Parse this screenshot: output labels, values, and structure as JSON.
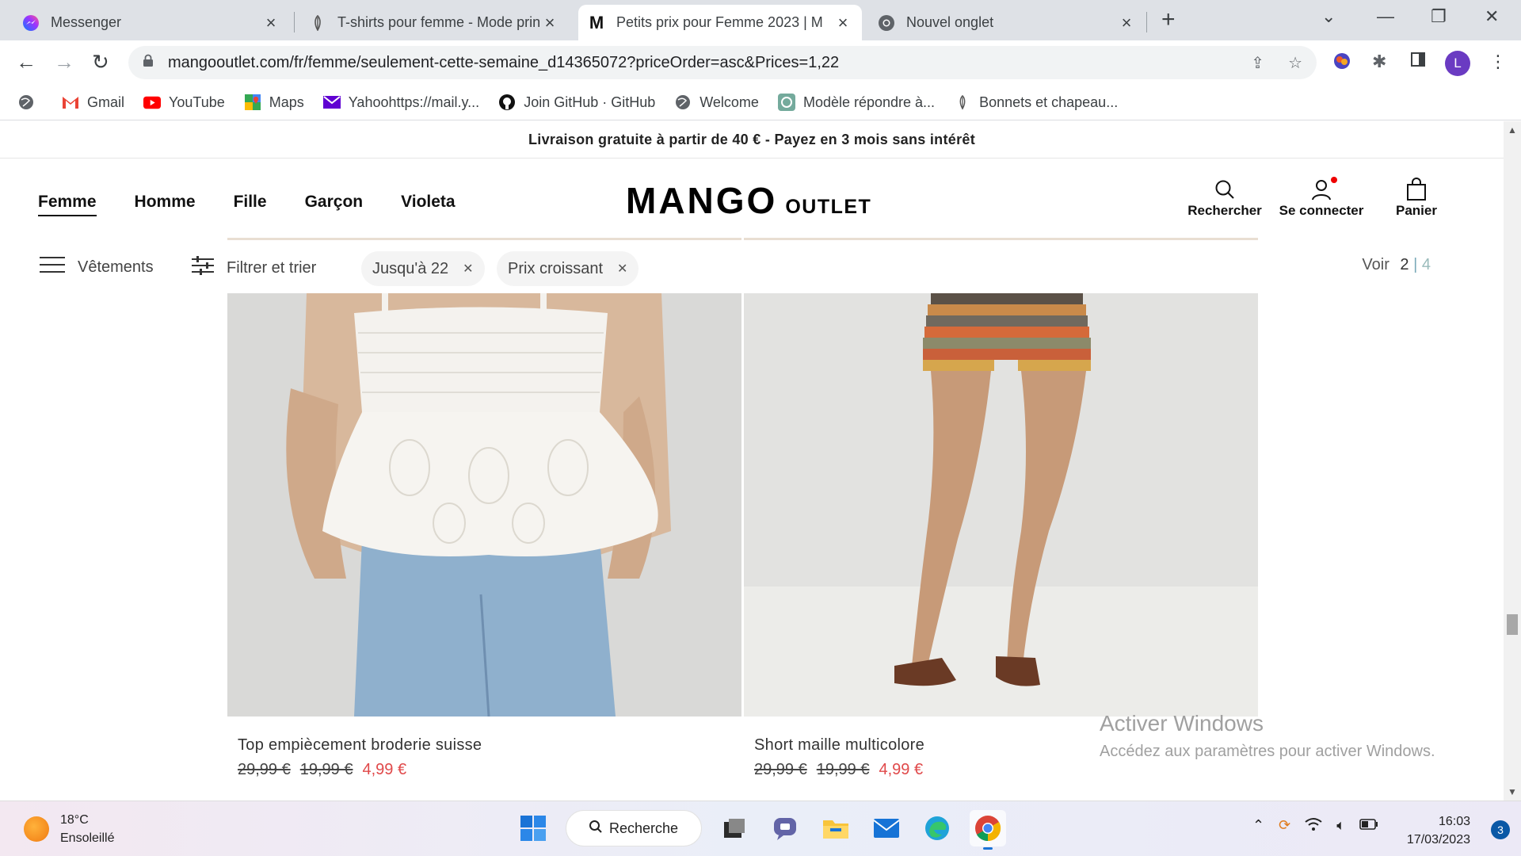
{
  "browser": {
    "tabs": [
      {
        "title": "Messenger",
        "icon": "messenger-icon"
      },
      {
        "title": "T-shirts pour femme - Mode prin",
        "icon": "feather-icon"
      },
      {
        "title": "Petits prix pour Femme 2023 | M",
        "icon": "mango-icon"
      },
      {
        "title": "Nouvel onglet",
        "icon": "chrome-icon"
      }
    ],
    "url": "mangooutlet.com/fr/femme/seulement-cette-semaine_d14365072?priceOrder=asc&Prices=1,22",
    "profile_initial": "L",
    "bookmarks": [
      {
        "label": "Gmail",
        "icon": "gmail-icon"
      },
      {
        "label": "YouTube",
        "icon": "youtube-icon"
      },
      {
        "label": "Maps",
        "icon": "maps-icon"
      },
      {
        "label": "Yahoohttps://mail.y...",
        "icon": "yahoo-icon"
      },
      {
        "label": "Join GitHub · GitHub",
        "icon": "github-icon"
      },
      {
        "label": "Welcome",
        "icon": "globe-icon"
      },
      {
        "label": "Modèle répondre à...",
        "icon": "openai-icon"
      },
      {
        "label": "Bonnets et chapeau...",
        "icon": "feather-icon"
      }
    ]
  },
  "site": {
    "promo": "Livraison gratuite à partir de 40 € - Payez en 3 mois sans intérêt",
    "nav": [
      "Femme",
      "Homme",
      "Fille",
      "Garçon",
      "Violeta"
    ],
    "logo_main": "MANGO",
    "logo_sub": "OUTLET",
    "header_actions": {
      "search": "Rechercher",
      "login": "Se connecter",
      "cart": "Panier"
    },
    "filters": {
      "category": "Vêtements",
      "filter_sort": "Filtrer et trier",
      "chips": [
        "Jusqu'à 22",
        "Prix croissant"
      ],
      "voir_label": "Voir",
      "voir_current": "2",
      "voir_sep": "|",
      "voir_alt": "4"
    },
    "products": [
      {
        "name": "Top empiècement broderie suisse",
        "original_price": "29,99 €",
        "previous_price": "19,99 €",
        "price": "4,99 €"
      },
      {
        "name": "Short maille multicolore",
        "original_price": "29,99 €",
        "previous_price": "19,99 €",
        "price": "4,99 €"
      }
    ]
  },
  "windows_watermark": {
    "title": "Activer Windows",
    "subtitle": "Accédez aux paramètres pour activer Windows."
  },
  "taskbar": {
    "temperature": "18°C",
    "weather": "Ensoleillé",
    "search": "Recherche",
    "time": "16:03",
    "date": "17/03/2023",
    "notifications": "3"
  },
  "colors": {
    "sale_price": "#e0494a",
    "chrome_tab_bar": "#dee1e6",
    "chip_bg": "#f4f4f4"
  }
}
